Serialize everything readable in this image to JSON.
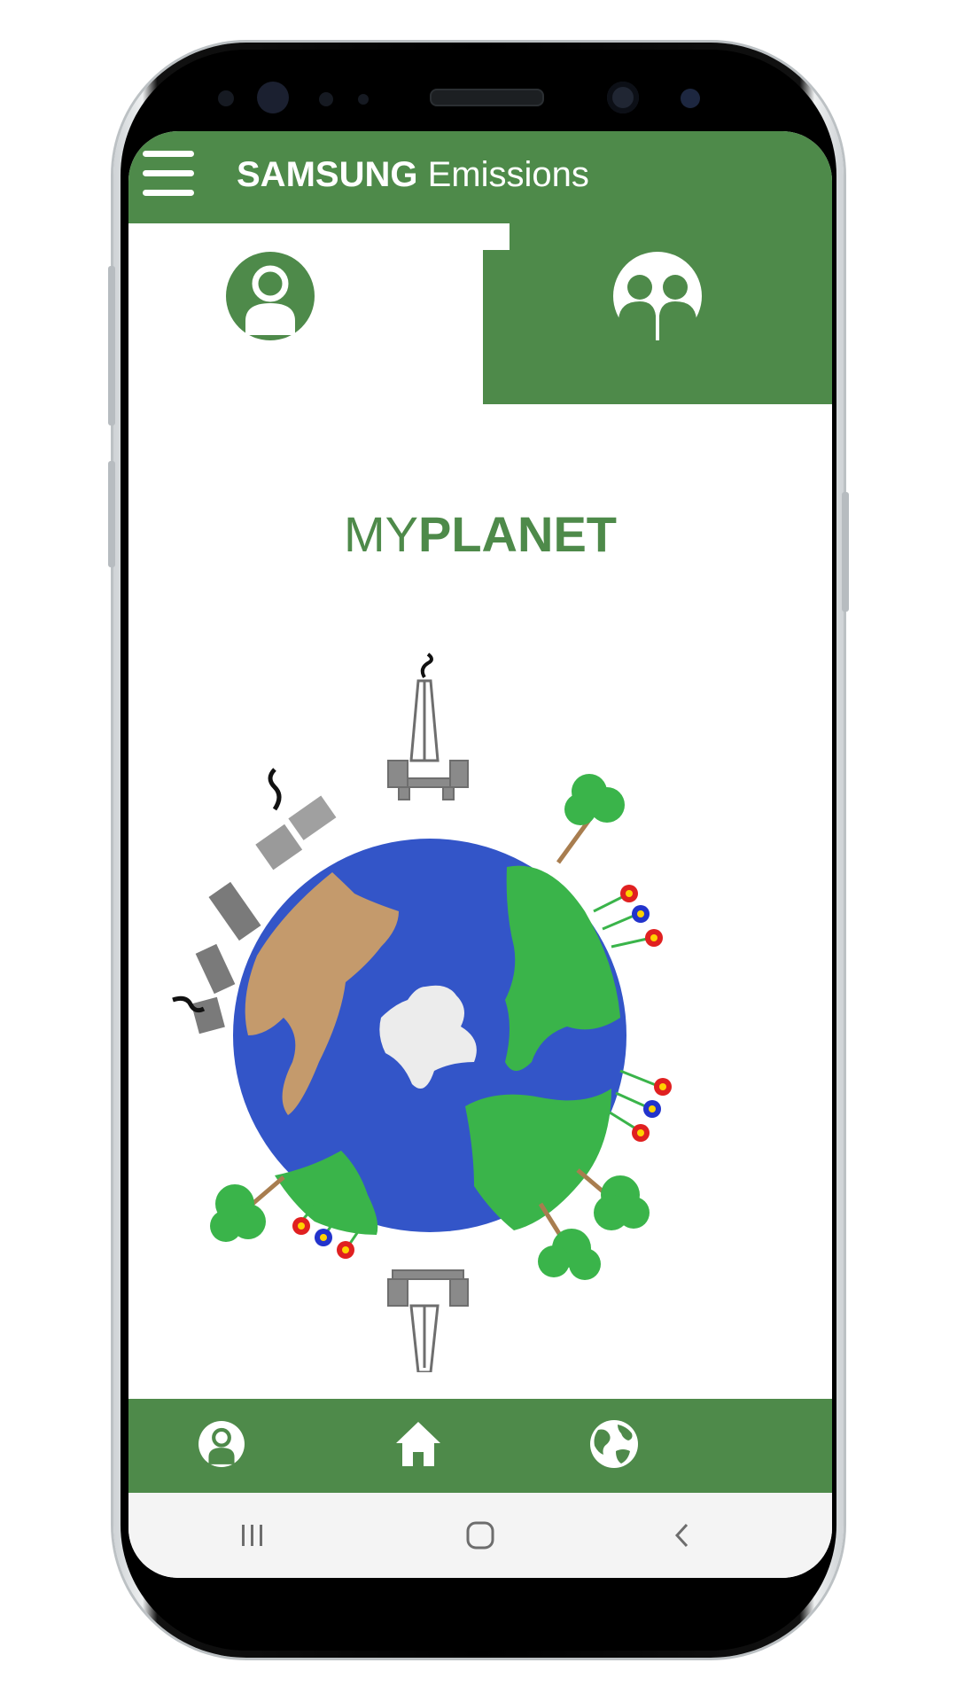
{
  "app": {
    "brand": "SAMSUNG",
    "title_suffix": "Emissions"
  },
  "tabs": [
    {
      "name": "individual",
      "icon": "person-icon",
      "selected": true
    },
    {
      "name": "group",
      "icon": "group-icon",
      "selected": false
    }
  ],
  "page": {
    "heading_thin": "MY",
    "heading_bold": "PLANET"
  },
  "bottom_nav": [
    {
      "icon": "person-icon"
    },
    {
      "icon": "home-icon"
    },
    {
      "icon": "globe-icon"
    }
  ],
  "system_nav": [
    {
      "icon": "recent-apps-icon"
    },
    {
      "icon": "home-circle-icon"
    },
    {
      "icon": "back-icon"
    }
  ],
  "colors": {
    "brand_green": "#4e8a4a",
    "ocean_blue": "#3355c8",
    "land_green": "#3ab44a",
    "land_brown": "#c49a6c",
    "ice": "#ececec"
  }
}
